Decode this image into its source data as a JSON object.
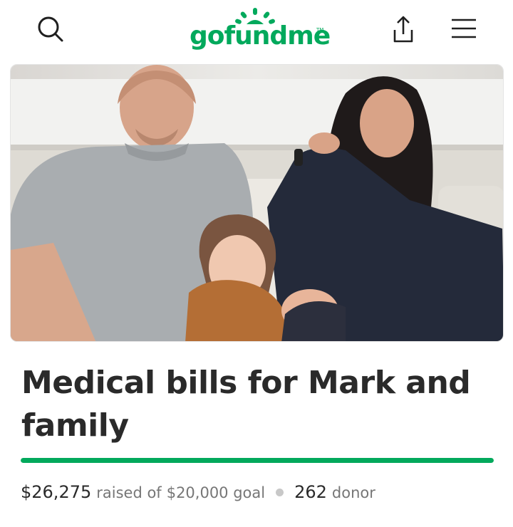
{
  "header": {
    "logo_text": "gofundme",
    "logo_tm": "TM",
    "brand_color": "#02a95c",
    "icons": {
      "search": "search-icon",
      "share": "share-icon",
      "menu": "hamburger-menu-icon"
    }
  },
  "campaign": {
    "title": "Medical bills for Mark and family",
    "raised": "$26,275",
    "raised_of": "raised of",
    "goal": "$20,000 goal",
    "donor_count": "262",
    "donor_label": "donor",
    "progress_fraction": 1.0
  }
}
